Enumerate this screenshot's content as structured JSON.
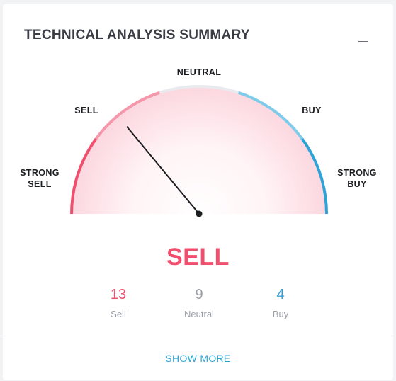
{
  "widget": {
    "title": "TECHNICAL ANALYSIS SUMMARY",
    "minimize_icon": "minimize-icon"
  },
  "gauge": {
    "labels": {
      "strong_sell": "STRONG\nSELL",
      "sell": "SELL",
      "neutral": "NEUTRAL",
      "buy": "BUY",
      "strong_buy": "STRONG\nBUY"
    },
    "colors": {
      "strong_sell": "#f0506e",
      "sell": "#f597aa",
      "neutral": "#e8eaee",
      "buy": "#7fcbea",
      "strong_buy": "#2fa3d8",
      "fill": "#fde3e8",
      "needle": "#1c1d21"
    },
    "needle_level": -0.44
  },
  "summary": {
    "verdict": "SELL",
    "verdict_color": "#f0506e"
  },
  "counts": [
    {
      "value": "13",
      "label": "Sell",
      "color": "#f0506e"
    },
    {
      "value": "9",
      "label": "Neutral",
      "color": "#9c9ea6"
    },
    {
      "value": "4",
      "label": "Buy",
      "color": "#2fa3d8"
    }
  ],
  "footer": {
    "show_more": "SHOW MORE"
  }
}
